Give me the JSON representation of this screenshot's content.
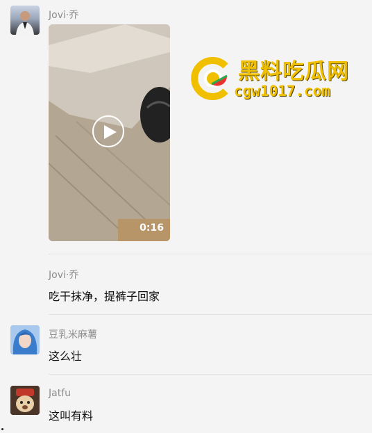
{
  "messages": [
    {
      "sender": "Jovi·乔",
      "video_duration": "0:16"
    },
    {
      "sender": "Jovi·乔",
      "text": "吃干抹净，提裤子回家"
    },
    {
      "sender": "豆乳米麻薯",
      "text": "这么壮"
    },
    {
      "sender": "Jatfu",
      "text": "这叫有料"
    }
  ],
  "watermark": {
    "title": "黑料吃瓜网",
    "url": "cgw1017.com",
    "color": "#f0c000"
  },
  "icons": {
    "play": "play-icon",
    "logo": "watermark-logo-icon"
  }
}
